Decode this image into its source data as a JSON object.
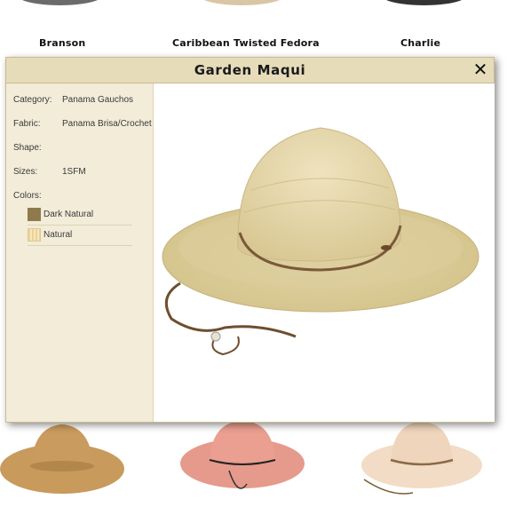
{
  "background": {
    "top_items": [
      {
        "name": "Branson"
      },
      {
        "name": "Caribbean Twisted Fedora"
      },
      {
        "name": "Charlie"
      }
    ]
  },
  "modal": {
    "title": "Garden Maqui",
    "close_glyph": "✕",
    "details": {
      "category": {
        "label": "Category:",
        "value": "Panama Gauchos"
      },
      "fabric": {
        "label": "Fabric:",
        "value": "Panama Brisa/Crochet"
      },
      "shape": {
        "label": "Shape:",
        "value": ""
      },
      "sizes": {
        "label": "Sizes:",
        "value": "1SFM"
      },
      "colors_label": "Colors:",
      "colors": [
        {
          "name": "Dark Natural",
          "swatch": "#8e7a4d"
        },
        {
          "name": "Natural",
          "swatch": "#f3e1ac"
        }
      ]
    },
    "image": {
      "icon": "straw-hat-icon"
    }
  },
  "colors": {
    "header_bg": "#e6dcba",
    "panel_bg": "#f1ebd9",
    "border": "#c9bb8f"
  }
}
